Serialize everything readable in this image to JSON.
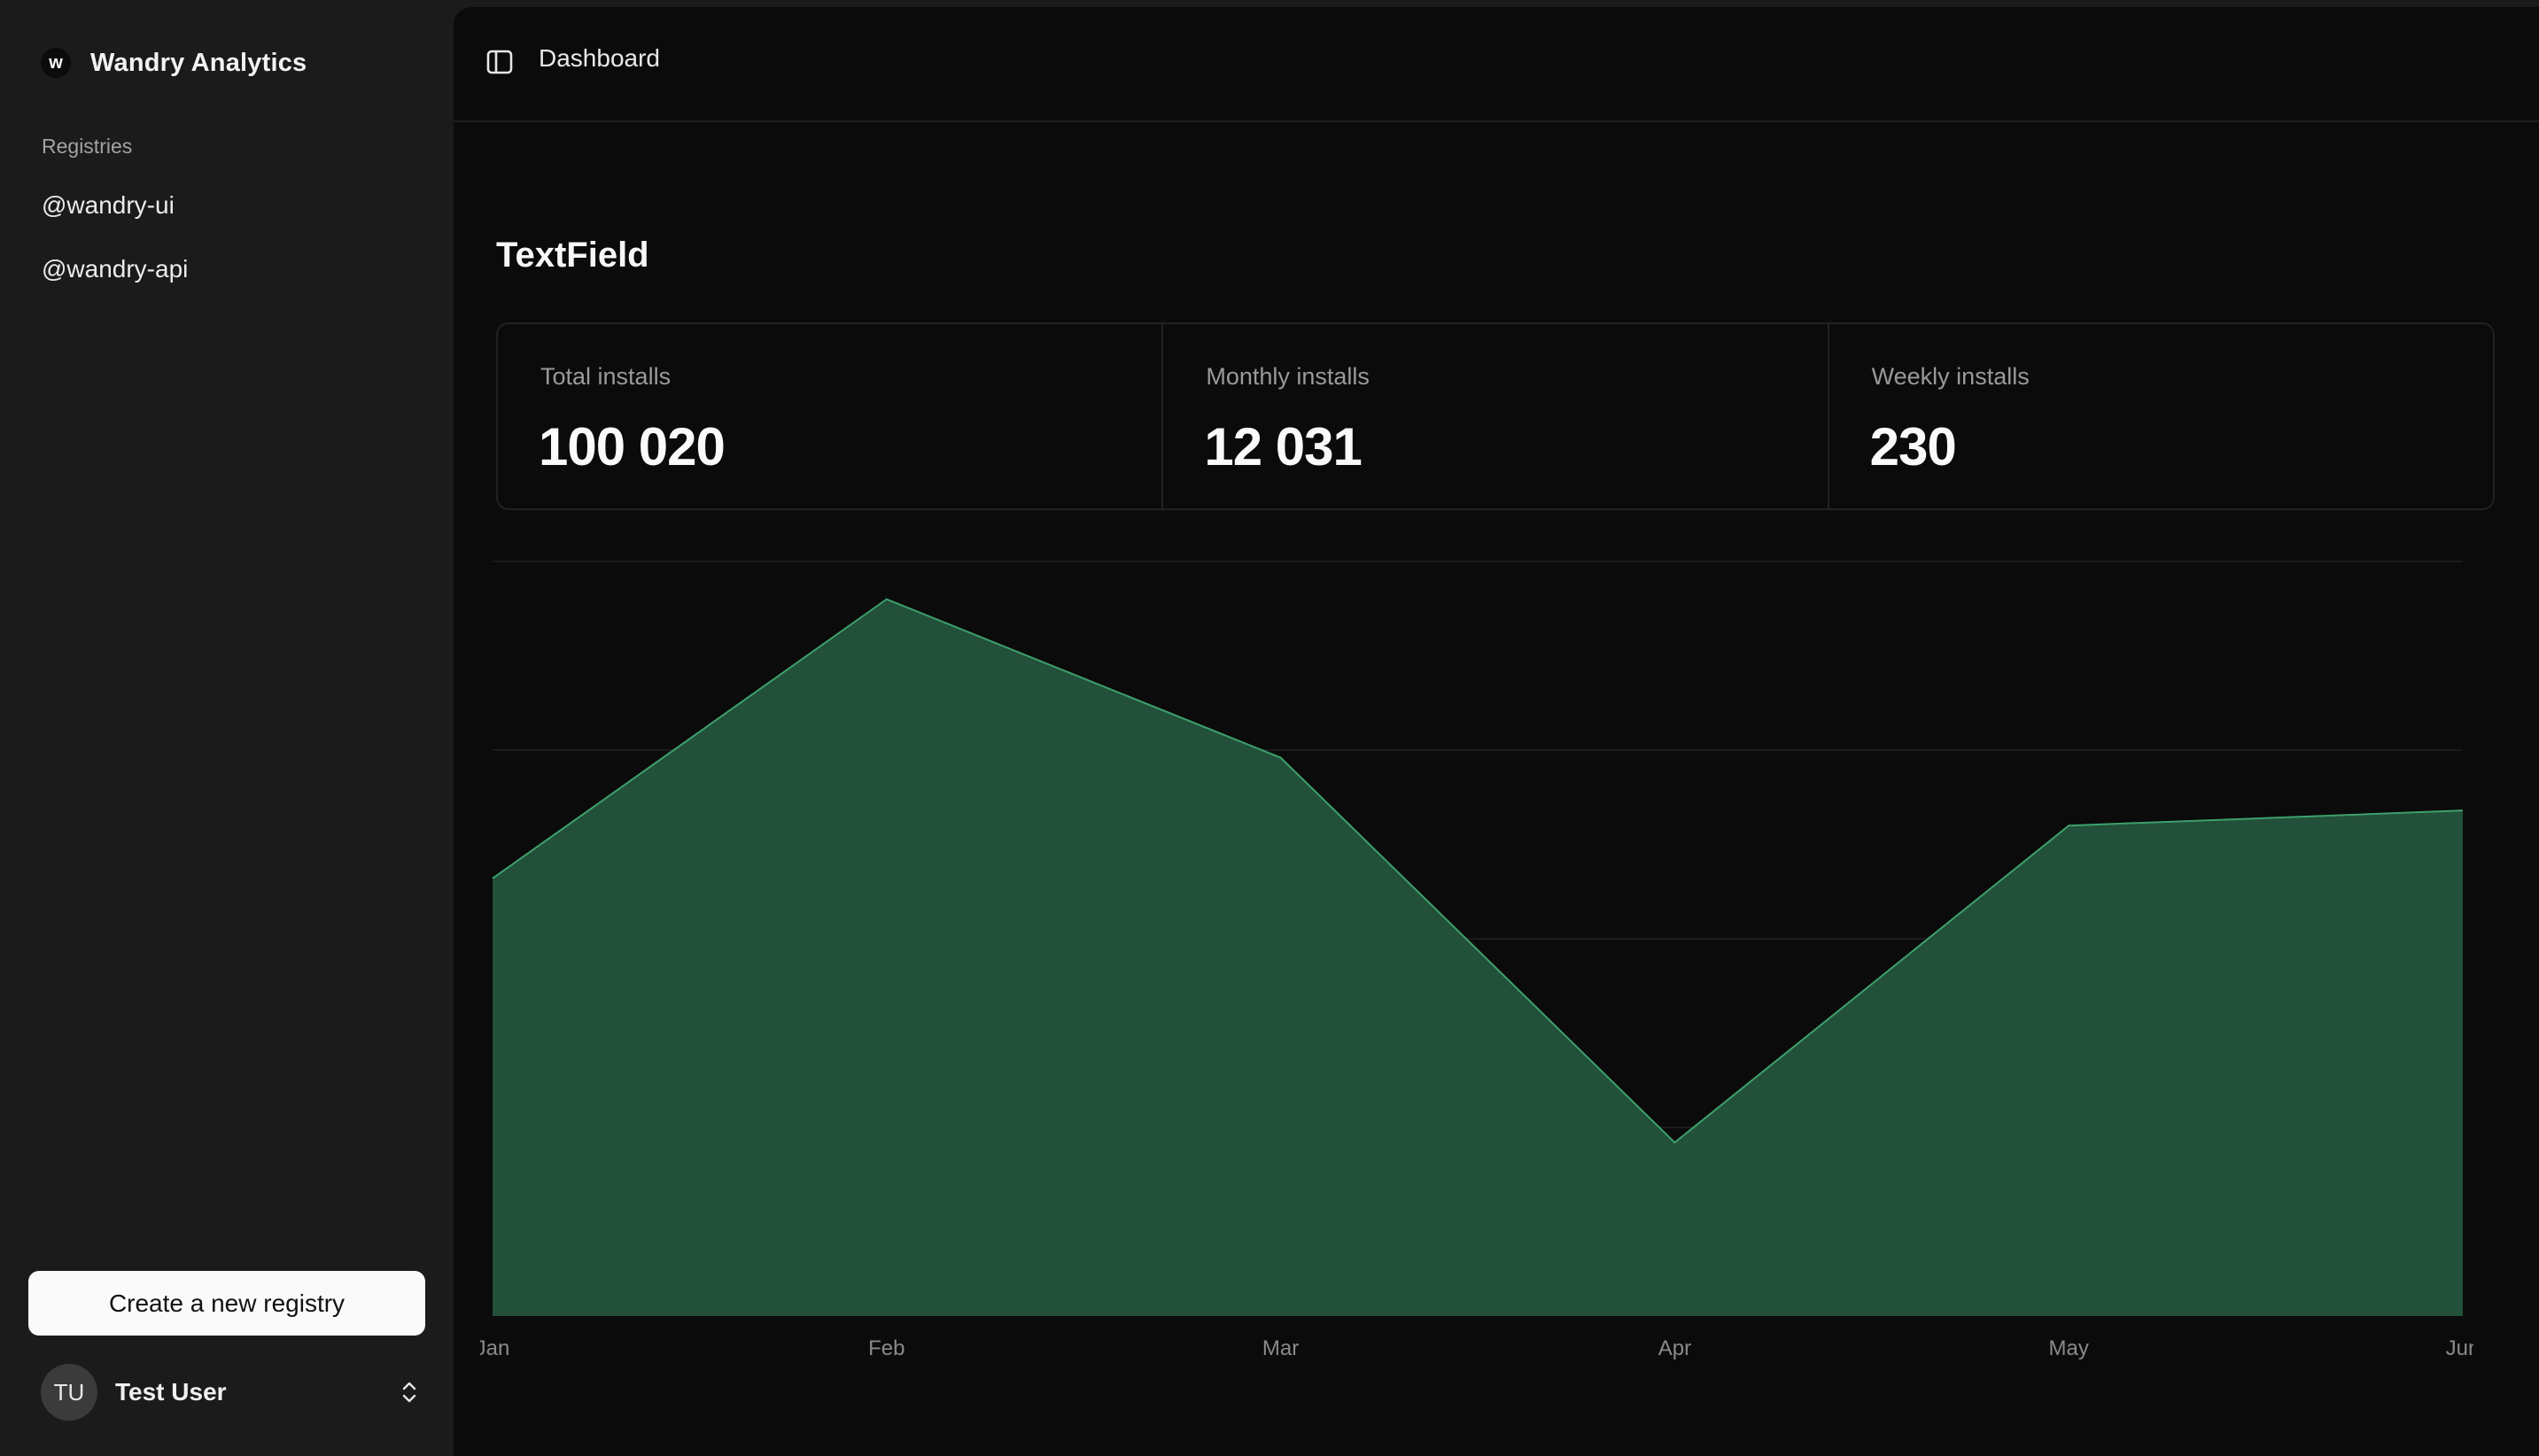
{
  "sidebar": {
    "brand": {
      "logo_letter": "w",
      "name": "Wandry Analytics"
    },
    "section_label": "Registries",
    "items": [
      {
        "label": "@wandry-ui"
      },
      {
        "label": "@wandry-api"
      }
    ],
    "create_button_label": "Create a new registry",
    "user": {
      "initials": "TU",
      "name": "Test User",
      "icon": "chevrons-up-down-icon"
    }
  },
  "header": {
    "toggle_icon": "sidebar-toggle-icon",
    "breadcrumb": "Dashboard"
  },
  "main": {
    "title": "TextField",
    "stats": [
      {
        "label": "Total installs",
        "value": "100 020"
      },
      {
        "label": "Monthly installs",
        "value": "12 031"
      },
      {
        "label": "Weekly installs",
        "value": "230"
      }
    ]
  },
  "colors": {
    "area_fill": "#22503a",
    "area_stroke": "#3ea06c",
    "grid": "#1c1c1c"
  },
  "chart_data": {
    "type": "area",
    "categories": [
      "Jan",
      "Feb",
      "Mar",
      "Apr",
      "May",
      "Jun"
    ],
    "series": [
      {
        "values": [
          58,
          95,
          74,
          23,
          65,
          67
        ]
      }
    ],
    "ylim": [
      0,
      100
    ],
    "grid": true,
    "y_gridlines": [
      25,
      50,
      75,
      100
    ],
    "title": "",
    "xlabel": "",
    "ylabel": ""
  }
}
